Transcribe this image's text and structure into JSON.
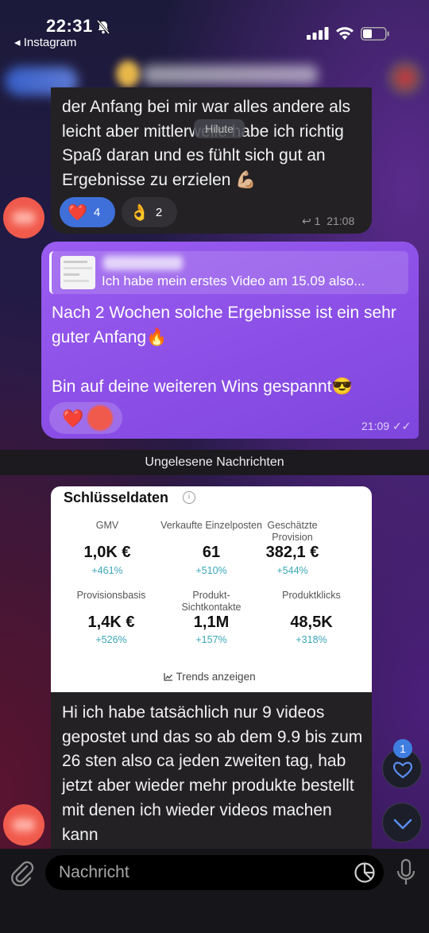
{
  "status_bar": {
    "time": "22:31",
    "back_app": "◂ Instagram"
  },
  "chat": {
    "messages": [
      {
        "text": "der Anfang bei mir war alles andere als leicht aber mittlerweile habe ich richtig Spaß daran und es fühlt sich gut an Ergebnisse zu erzielen 💪🏼",
        "overlay": "Hilute",
        "reactions": [
          {
            "emoji": "❤️",
            "count": "4"
          },
          {
            "emoji": "👌",
            "count": "2"
          }
        ],
        "replies": "1",
        "time": "21:08"
      },
      {
        "reply_preview": "Ich habe mein erstes Video am 15.09 also...",
        "text_1": "Nach 2 Wochen solche Ergebnisse ist ein sehr guter Anfang🔥",
        "text_2": "Bin auf deine weiteren Wins gespannt😎",
        "reaction": "❤️",
        "time": "21:09"
      }
    ],
    "unread_label": "Ungelesene Nachrichten",
    "card": {
      "title": "Schlüsseldaten",
      "metrics": [
        {
          "label": "GMV",
          "value": "1,0K €",
          "delta": "+461%"
        },
        {
          "label": "Verkaufte Einzelposten",
          "value": "61",
          "delta": "+510%"
        },
        {
          "label": "Geschätzte Provision",
          "value": "382,1 €",
          "delta": "+544%"
        },
        {
          "label": "Provisionsbasis",
          "value": "1,4K €",
          "delta": "+526%"
        },
        {
          "label": "Produkt-Sichtkontakte",
          "value": "1,1M",
          "delta": "+157%"
        },
        {
          "label": "Produktklicks",
          "value": "48,5K",
          "delta": "+318%"
        }
      ],
      "trends_label": "Trends anzeigen"
    },
    "last_message": "Hi ich habe tatsächlich nur 9 videos gepostet und das so ab dem 9.9 bis zum 26 sten also ca jeden zweiten tag, hab jetzt aber wieder mehr produkte bestellt mit denen ich wieder videos machen kann",
    "unread_badge": "1"
  },
  "composer": {
    "placeholder": "Nachricht"
  },
  "colors": {
    "outgoing_bubble": "#8a4ee6",
    "incoming_bubble": "#232124",
    "reaction_active": "#3f6fd9",
    "delta_color": "#3aa7b8",
    "badge": "#3f7de0"
  }
}
